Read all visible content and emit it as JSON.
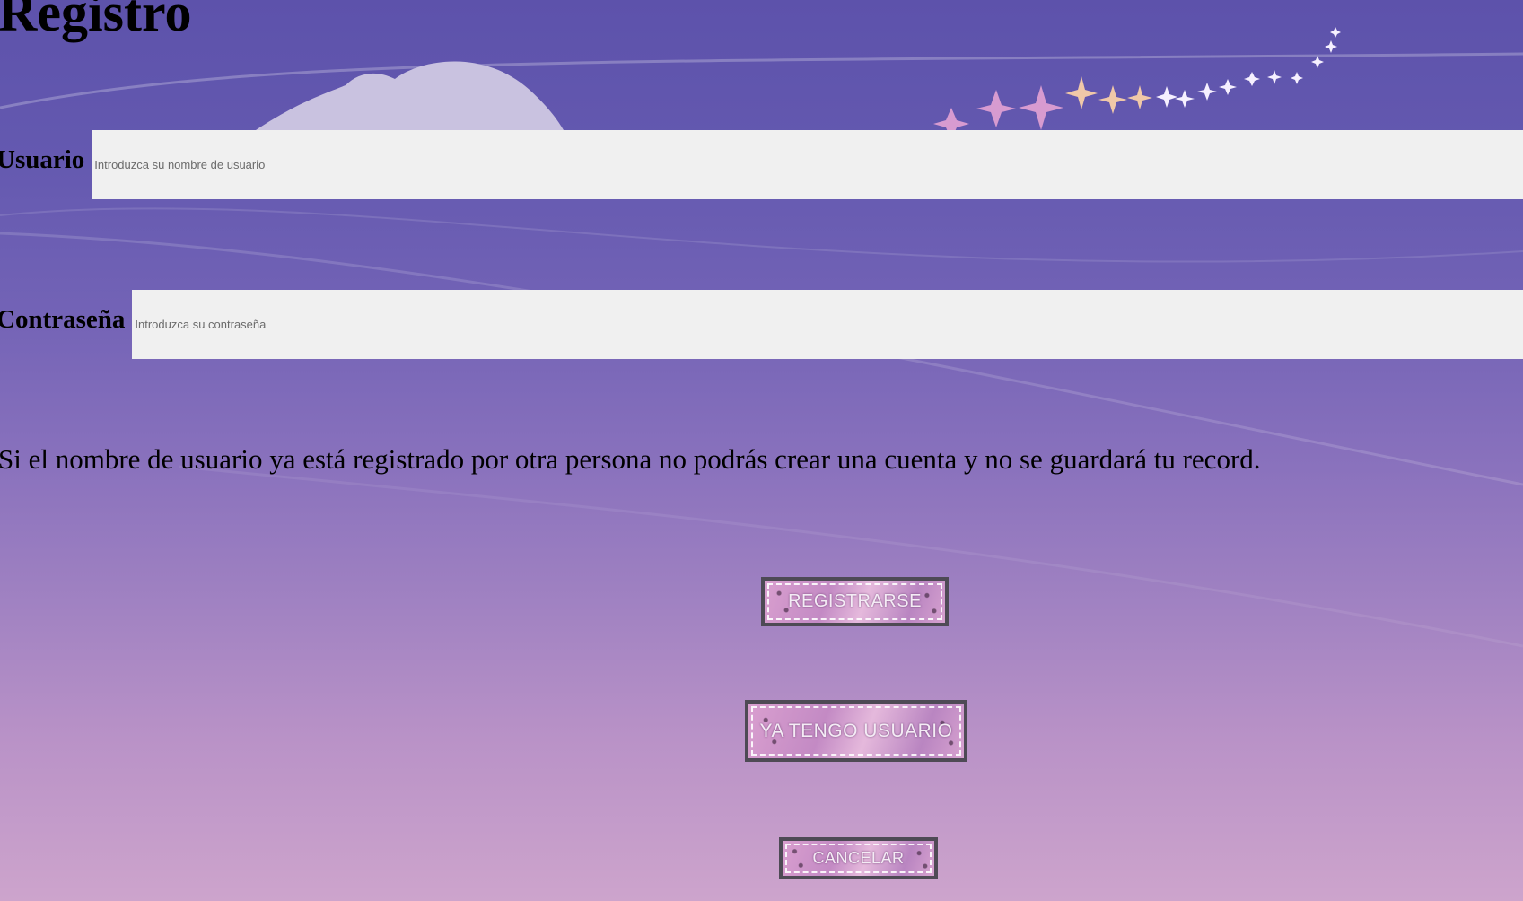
{
  "page": {
    "title": "Registro"
  },
  "form": {
    "username": {
      "label": "Usuario",
      "placeholder": "Introduzca su nombre de usuario",
      "value": ""
    },
    "password": {
      "label": "Contraseña",
      "placeholder": "Introduzca su contraseña",
      "value": ""
    }
  },
  "notice": "Si el nombre de usuario ya está registrado por otra persona no podrás crear una cuenta y no se guardará tu record.",
  "buttons": {
    "register": "REGISTRARSE",
    "have_user": "YA TENGO USUARIO",
    "cancel": "CANCELAR"
  },
  "theme": {
    "background_top": "#5d52ab",
    "background_bottom": "#cda4cc",
    "input_background": "#f0f0f0",
    "button_border": "#4e4a55"
  }
}
